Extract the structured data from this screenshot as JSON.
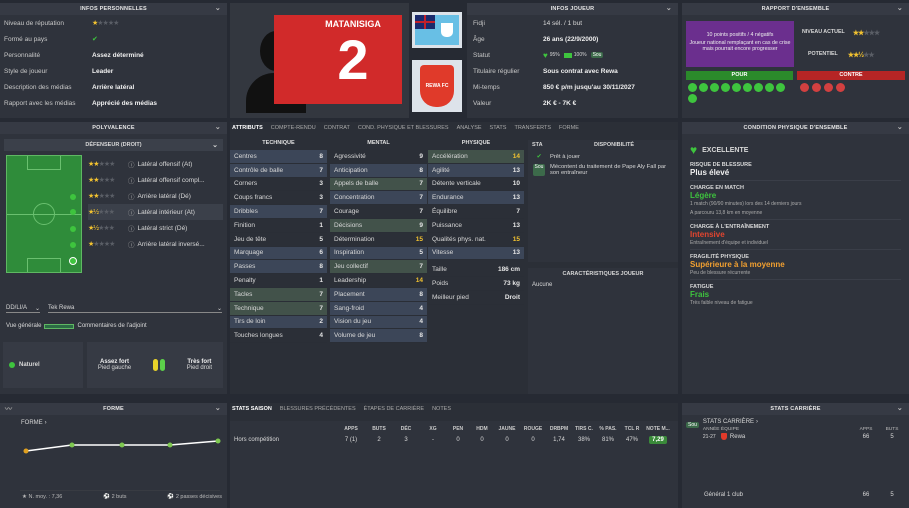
{
  "personal": {
    "header": "INFOS PERSONNELLES",
    "rows": [
      {
        "label": "Niveau de réputation",
        "value": ""
      },
      {
        "label": "Formé au pays",
        "value": ""
      },
      {
        "label": "Personnalité",
        "value": "Assez déterminé"
      },
      {
        "label": "Style de joueur",
        "value": "Leader"
      },
      {
        "label": "Description des médias",
        "value": "Arrière latéral"
      },
      {
        "label": "Rapport avec les médias",
        "value": "Apprécié des médias"
      }
    ]
  },
  "player": {
    "name": "MATANISIGA",
    "number": "2",
    "club_crest_text": "REWA FC"
  },
  "info_joueur": {
    "header": "INFOS JOUEUR",
    "nation": "Fidji",
    "caps": "14 sél. / 1 but",
    "age_label": "Âge",
    "age": "26 ans (22/9/2000)",
    "statut_label": "Statut",
    "statut_pct1": "95%",
    "statut_pct2": "100%",
    "statut_badge": "Sou",
    "titulaire_label": "Titulaire régulier",
    "titulaire_value": "Sous contrat avec Rewa",
    "mitemps_label": "Mi-temps",
    "mitemps_value": "850 € p/m jusqu'au 30/11/2027",
    "valeur_label": "Valeur",
    "valeur_value": "2K € - 7K €"
  },
  "rapport": {
    "header": "RAPPORT D'ENSEMBLE",
    "box_text": "10 points positifs / 4 négatifs",
    "box_sub": "Joueur national remplaçant en cas de crise mais pourrait encore progresser",
    "niveau_label": "NIVEAU ACTUEL",
    "potentiel_label": "POTENTIEL",
    "pour": "POUR",
    "contre": "CONTRE"
  },
  "polyvalence": {
    "header": "POLYVALENCE",
    "select": "DÉFENSEUR (DROIT)",
    "roles": [
      {
        "label": "Latéral offensif (At)"
      },
      {
        "label": "Latéral offensif compl..."
      },
      {
        "label": "Arrière latéral (Dé)"
      },
      {
        "label": "Latéral intérieur (At)"
      },
      {
        "label": "Latéral strict (Dé)"
      },
      {
        "label": "Arrière latéral inversé..."
      }
    ],
    "pos_code": "DD/LI/A",
    "club": "Tek Rewa",
    "vue_label": "Vue générale",
    "vue_text": "Commentaires de l'adjoint",
    "naturel": "Naturel",
    "pied_gauche_title": "Assez fort",
    "pied_gauche_sub": "Pied gauche",
    "pied_droit_title": "Très fort",
    "pied_droit_sub": "Pied droit"
  },
  "tabs": [
    "ATTRIBUTS",
    "COMPTE-RENDU",
    "CONTRAT",
    "COND. PHYSIQUE ET BLESSURES",
    "ANALYSE",
    "STATS",
    "TRANSFERTS",
    "FORME"
  ],
  "attributes": {
    "technique_header": "TECHNIQUE",
    "mental_header": "MENTAL",
    "physique_header": "PHYSIQUE",
    "technique": [
      {
        "name": "Centres",
        "value": "8"
      },
      {
        "name": "Contrôle de balle",
        "value": "7"
      },
      {
        "name": "Corners",
        "value": "3"
      },
      {
        "name": "Coups francs",
        "value": "3"
      },
      {
        "name": "Dribbles",
        "value": "7"
      },
      {
        "name": "Finition",
        "value": "1"
      },
      {
        "name": "Jeu de tête",
        "value": "5"
      },
      {
        "name": "Marquage",
        "value": "6"
      },
      {
        "name": "Passes",
        "value": "8"
      },
      {
        "name": "Penalty",
        "value": "1"
      },
      {
        "name": "Tacles",
        "value": "7"
      },
      {
        "name": "Technique",
        "value": "7"
      },
      {
        "name": "Tirs de loin",
        "value": "2"
      },
      {
        "name": "Touches longues",
        "value": "4"
      }
    ],
    "mental": [
      {
        "name": "Agressivité",
        "value": "9"
      },
      {
        "name": "Anticipation",
        "value": "8"
      },
      {
        "name": "Appels de balle",
        "value": "7"
      },
      {
        "name": "Concentration",
        "value": "7"
      },
      {
        "name": "Courage",
        "value": "7"
      },
      {
        "name": "Décisions",
        "value": "9"
      },
      {
        "name": "Détermination",
        "value": "15"
      },
      {
        "name": "Inspiration",
        "value": "5"
      },
      {
        "name": "Jeu collectif",
        "value": "7"
      },
      {
        "name": "Leadership",
        "value": "14"
      },
      {
        "name": "Placement",
        "value": "8"
      },
      {
        "name": "Sang-froid",
        "value": "4"
      },
      {
        "name": "Vision du jeu",
        "value": "4"
      },
      {
        "name": "Volume de jeu",
        "value": "8"
      }
    ],
    "physique": [
      {
        "name": "Accélération",
        "value": "14"
      },
      {
        "name": "Agilité",
        "value": "13"
      },
      {
        "name": "Détente verticale",
        "value": "10"
      },
      {
        "name": "Endurance",
        "value": "13"
      },
      {
        "name": "Équilibre",
        "value": "7"
      },
      {
        "name": "Puissance",
        "value": "13"
      },
      {
        "name": "Qualités phys. nat.",
        "value": "15"
      },
      {
        "name": "Vitesse",
        "value": "13"
      }
    ],
    "taille_label": "Taille",
    "taille": "186 cm",
    "poids_label": "Poids",
    "poids": "73 kg",
    "pied_label": "Meilleur pied",
    "pied": "Droit"
  },
  "dispo": {
    "sta": "STA",
    "header": "DISPONIBILITÉ",
    "line1": "Prêt à jouer",
    "badge": "Sou",
    "line2": "Mécontent du traitement de Pape Aly Fall par son entraîneur"
  },
  "caract": {
    "header": "CARACTÉRISTIQUES JOUEUR",
    "value": "Aucune"
  },
  "condition": {
    "header": "CONDITION PHYSIQUE D'ENSEMBLE",
    "status": "EXCELLENTE",
    "items": [
      {
        "title": "RISQUE DE BLESSURE",
        "value": "Plus élevé",
        "desc": ""
      },
      {
        "title": "CHARGE EN MATCH",
        "value": "Légère",
        "desc": "1 match (90/90 minutes) lors des 14 derniers jours",
        "desc2": "A parcouru 13,8 km en moyenne"
      },
      {
        "title": "CHARGE À L'ENTRAÎNEMENT",
        "value": "Intensive",
        "desc": "Entraînement d'équipe et individuel"
      },
      {
        "title": "FRAGILITÉ PHYSIQUE",
        "value": "Supérieure à la moyenne",
        "desc": "Peu de blessure récurrente"
      },
      {
        "title": "FATIGUE",
        "value": "Frais",
        "desc": "Très faible niveau de fatigue"
      }
    ]
  },
  "forme": {
    "header": "FORME",
    "label": "FORME",
    "moy": "N. moy. : 7,36",
    "buts": "2 buts",
    "passes": "2 passes décisives"
  },
  "stats": {
    "tabs": [
      "STATS SAISON",
      "BLESSURES PRÉCÉDENTES",
      "ÉTAPES DE CARRIÈRE",
      "NOTES"
    ],
    "columns": [
      "APPS",
      "BUTS",
      "DÉC",
      "XG",
      "PEN",
      "HDM",
      "JAUNE",
      "ROUGE",
      "DRBPM",
      "TIRS C.",
      "% PAS.",
      "TCL R",
      "NOTE M..."
    ],
    "row_label": "Hors compétition",
    "row": [
      "7 (1)",
      "2",
      "3",
      "-",
      "0",
      "0",
      "0",
      "0",
      "1,74",
      "38%",
      "81%",
      "47%",
      "7,29"
    ]
  },
  "career": {
    "header": "STATS CARRIÈRE",
    "title": "STATS CARRIÈRE",
    "badge": "Sou",
    "col_annee": "ANNÉE",
    "col_equipe": "ÉQUIPE",
    "col_apps": "APPS",
    "col_buts": "BUTS",
    "year": "21-27",
    "team": "Rewa",
    "apps": "66",
    "buts": "5",
    "total_label": "Général 1 club",
    "total_apps": "66",
    "total_buts": "5"
  },
  "colors": {
    "green": "#3ec43e",
    "yellow": "#f2c230",
    "red": "#c23030",
    "purple": "#6a2a8a",
    "orange": "#f2a030"
  }
}
